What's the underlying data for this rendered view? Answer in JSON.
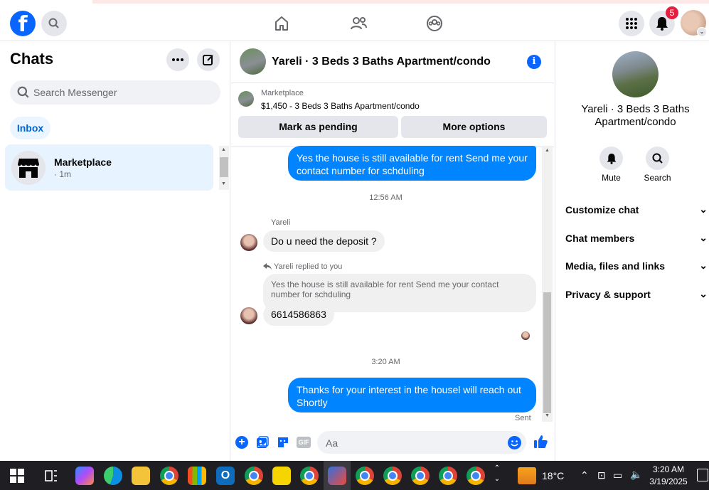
{
  "topbar": {
    "notif_count": "5"
  },
  "left": {
    "title": "Chats",
    "search_placeholder": "Search Messenger",
    "inbox_label": "Inbox",
    "conversation": {
      "name": "Marketplace",
      "time": "· 1m"
    }
  },
  "chat": {
    "header_title": "Yareli · 3 Beds 3 Baths Apartment/condo",
    "mp_label": "Marketplace",
    "mp_listing": "$1,450 - 3 Beds 3 Baths Apartment/condo",
    "mark_pending": "Mark as pending",
    "more_options": "More options",
    "msg1": "Yes the house is still available for rent Send me your contact number for schduling",
    "time1": "12:56 AM",
    "sender": "Yareli",
    "msg2": "Do u need the deposit ?",
    "reply_label": "Yareli replied to you",
    "quoted": "Yes the house is still available for rent Send me your contact number for schduling",
    "msg3": "6614586863",
    "time2": "3:20 AM",
    "msg4": "Thanks for your interest in the housel will reach out Shortly",
    "sent": "Sent",
    "composer_placeholder": "Aa"
  },
  "right": {
    "name": "Yareli · 3 Beds 3 Baths Apartment/condo",
    "mute": "Mute",
    "search": "Search",
    "sections": [
      "Customize chat",
      "Chat members",
      "Media, files and links",
      "Privacy & support"
    ]
  },
  "taskbar": {
    "temp": "18°C",
    "time": "3:20 AM",
    "date": "3/19/2025"
  },
  "colors": {
    "accent": "#0866ff",
    "bubble": "#0084ff",
    "badge": "#e41e3f"
  }
}
